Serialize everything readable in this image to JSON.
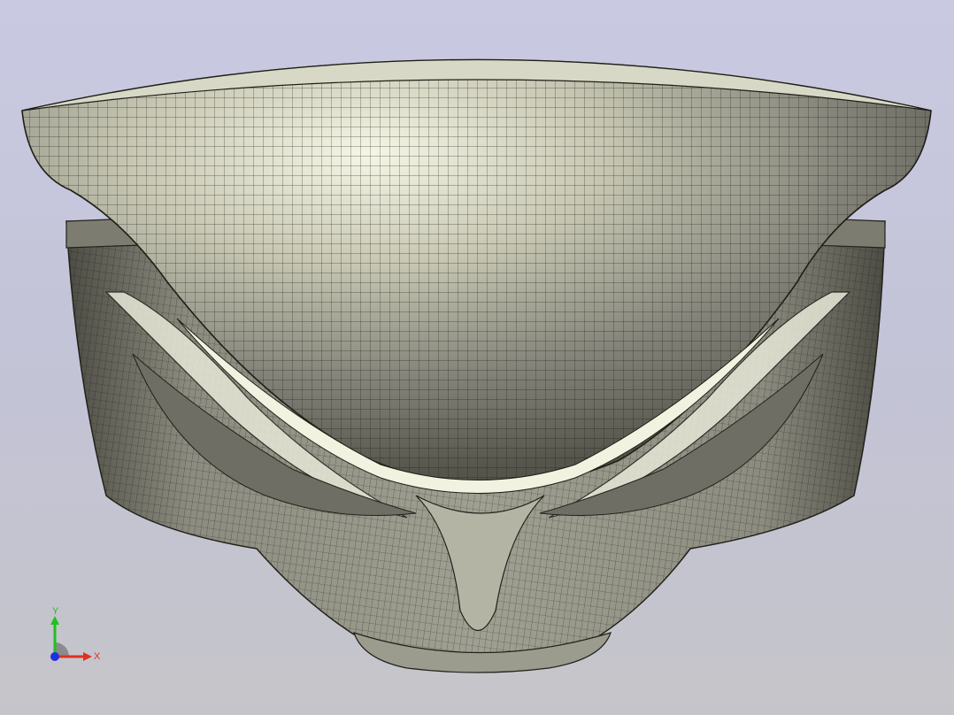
{
  "viewport": {
    "background_top": "#c9c9e2",
    "background_bottom": "#c5c5c9"
  },
  "model": {
    "name": "mask-mesh-model",
    "shade_light": "#f4f4e4",
    "shade_mid": "#9a9a88",
    "shade_dark": "#3e3e36",
    "mesh_line": "#1a1a14"
  },
  "triad": {
    "x_label": "X",
    "y_label": "Y",
    "x_color": "#e03020",
    "y_color": "#20c020",
    "z_color": "#2030e0"
  }
}
